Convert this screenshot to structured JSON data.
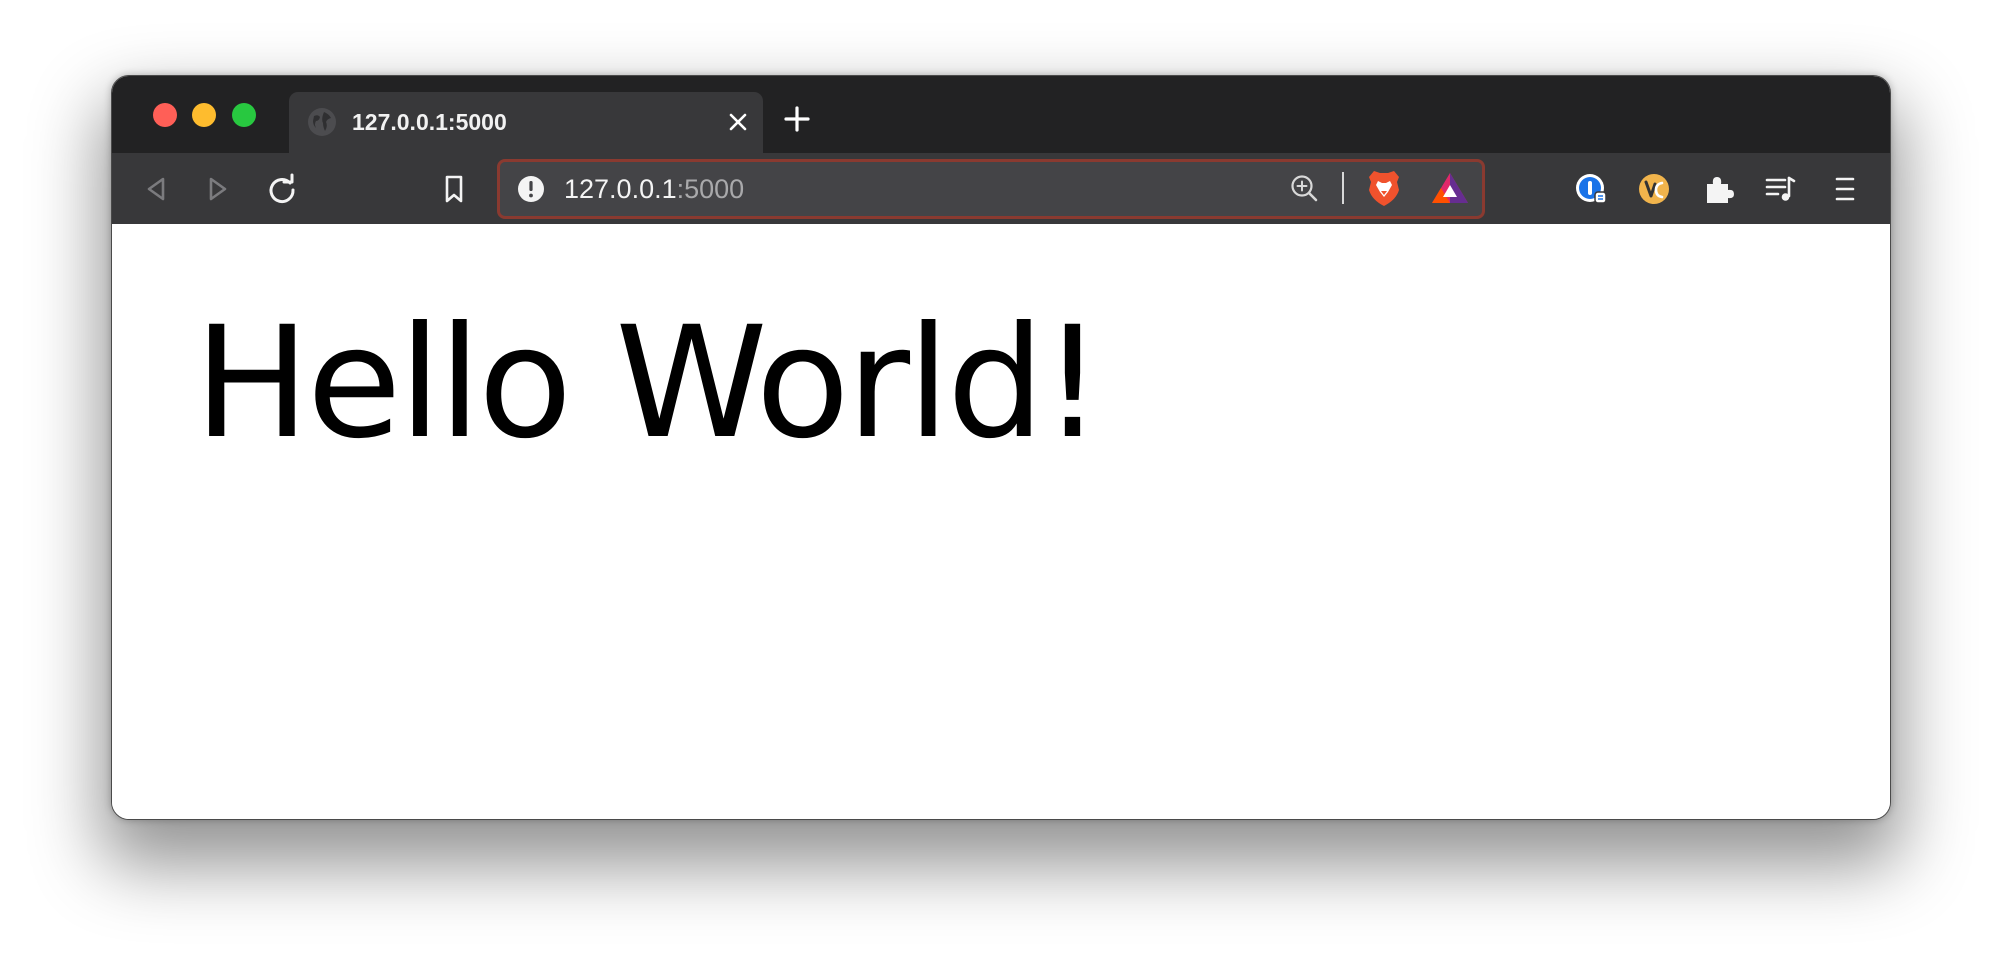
{
  "window": {
    "traffic_lights": [
      {
        "name": "close",
        "color": "#ff5f57"
      },
      {
        "name": "minimize",
        "color": "#febc2e"
      },
      {
        "name": "zoom",
        "color": "#28c840"
      }
    ]
  },
  "tab": {
    "title": "127.0.0.1:5000",
    "favicon": "globe-icon",
    "close_icon": "close-icon"
  },
  "new_tab_icon": "plus-icon",
  "toolbar": {
    "nav_icons": [
      "back-icon",
      "forward-icon",
      "reload-icon",
      "bookmark-icon"
    ],
    "url": {
      "host": "127.0.0.1",
      "port": ":5000",
      "info_icon": "site-info-icon",
      "zoom_icon": "zoom-in-icon",
      "extensions": [
        "brave-shields-icon",
        "brave-rewards-icon"
      ]
    },
    "right_icons": [
      "onepassword-icon",
      "vimium-c-icon",
      "extensions-puzzle-icon",
      "media-queue-icon",
      "menu-icon"
    ]
  },
  "page": {
    "heading": "Hello World!"
  },
  "colors": {
    "titlebar_bg": "#222223",
    "toolbar_bg": "#38383a",
    "urlbar_bg": "#444447",
    "urlbar_border": "#8a3a30",
    "brave_orange": "#f0522d",
    "vimium_yellow": "#f1b44c",
    "onepassword_blue": "#1a73e8"
  }
}
